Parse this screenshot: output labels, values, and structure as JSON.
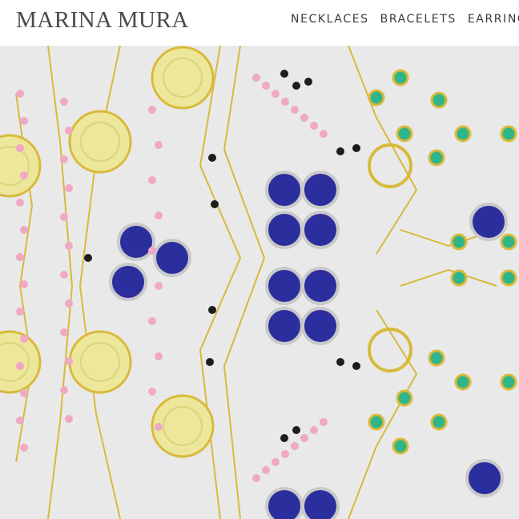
{
  "brand": {
    "name": "MARINA MURA"
  },
  "nav": {
    "items": [
      {
        "label": "NECKLACES"
      },
      {
        "label": "BRACELETS"
      },
      {
        "label": "EARRINGS"
      }
    ]
  },
  "hero": {
    "image": "kaleidoscope-jewelry-collage",
    "colors": {
      "background": "#e9e9e9",
      "gold": "#d9b93a",
      "lemon_quartz": "#ece79a",
      "lapis": "#2b2f9e",
      "emerald": "#2fb58a",
      "pink_tourmaline": "#f0a9c4",
      "black_spinel": "#1d1d1d"
    }
  }
}
